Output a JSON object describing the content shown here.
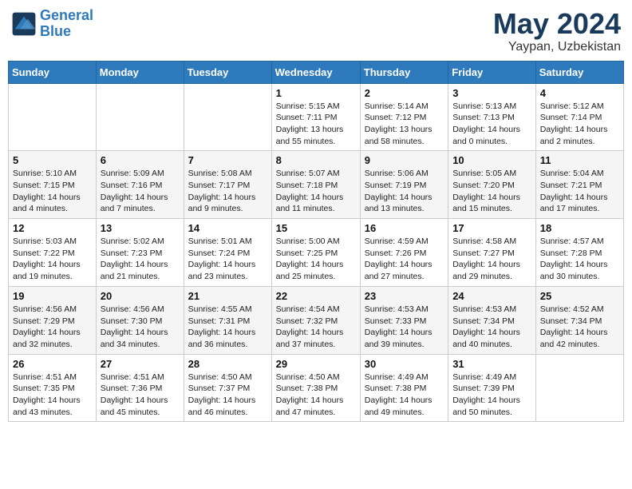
{
  "header": {
    "logo_line1": "General",
    "logo_line2": "Blue",
    "month_year": "May 2024",
    "location": "Yaypan, Uzbekistan"
  },
  "weekdays": [
    "Sunday",
    "Monday",
    "Tuesday",
    "Wednesday",
    "Thursday",
    "Friday",
    "Saturday"
  ],
  "weeks": [
    [
      {
        "day": "",
        "info": ""
      },
      {
        "day": "",
        "info": ""
      },
      {
        "day": "",
        "info": ""
      },
      {
        "day": "1",
        "info": "Sunrise: 5:15 AM\nSunset: 7:11 PM\nDaylight: 13 hours\nand 55 minutes."
      },
      {
        "day": "2",
        "info": "Sunrise: 5:14 AM\nSunset: 7:12 PM\nDaylight: 13 hours\nand 58 minutes."
      },
      {
        "day": "3",
        "info": "Sunrise: 5:13 AM\nSunset: 7:13 PM\nDaylight: 14 hours\nand 0 minutes."
      },
      {
        "day": "4",
        "info": "Sunrise: 5:12 AM\nSunset: 7:14 PM\nDaylight: 14 hours\nand 2 minutes."
      }
    ],
    [
      {
        "day": "5",
        "info": "Sunrise: 5:10 AM\nSunset: 7:15 PM\nDaylight: 14 hours\nand 4 minutes."
      },
      {
        "day": "6",
        "info": "Sunrise: 5:09 AM\nSunset: 7:16 PM\nDaylight: 14 hours\nand 7 minutes."
      },
      {
        "day": "7",
        "info": "Sunrise: 5:08 AM\nSunset: 7:17 PM\nDaylight: 14 hours\nand 9 minutes."
      },
      {
        "day": "8",
        "info": "Sunrise: 5:07 AM\nSunset: 7:18 PM\nDaylight: 14 hours\nand 11 minutes."
      },
      {
        "day": "9",
        "info": "Sunrise: 5:06 AM\nSunset: 7:19 PM\nDaylight: 14 hours\nand 13 minutes."
      },
      {
        "day": "10",
        "info": "Sunrise: 5:05 AM\nSunset: 7:20 PM\nDaylight: 14 hours\nand 15 minutes."
      },
      {
        "day": "11",
        "info": "Sunrise: 5:04 AM\nSunset: 7:21 PM\nDaylight: 14 hours\nand 17 minutes."
      }
    ],
    [
      {
        "day": "12",
        "info": "Sunrise: 5:03 AM\nSunset: 7:22 PM\nDaylight: 14 hours\nand 19 minutes."
      },
      {
        "day": "13",
        "info": "Sunrise: 5:02 AM\nSunset: 7:23 PM\nDaylight: 14 hours\nand 21 minutes."
      },
      {
        "day": "14",
        "info": "Sunrise: 5:01 AM\nSunset: 7:24 PM\nDaylight: 14 hours\nand 23 minutes."
      },
      {
        "day": "15",
        "info": "Sunrise: 5:00 AM\nSunset: 7:25 PM\nDaylight: 14 hours\nand 25 minutes."
      },
      {
        "day": "16",
        "info": "Sunrise: 4:59 AM\nSunset: 7:26 PM\nDaylight: 14 hours\nand 27 minutes."
      },
      {
        "day": "17",
        "info": "Sunrise: 4:58 AM\nSunset: 7:27 PM\nDaylight: 14 hours\nand 29 minutes."
      },
      {
        "day": "18",
        "info": "Sunrise: 4:57 AM\nSunset: 7:28 PM\nDaylight: 14 hours\nand 30 minutes."
      }
    ],
    [
      {
        "day": "19",
        "info": "Sunrise: 4:56 AM\nSunset: 7:29 PM\nDaylight: 14 hours\nand 32 minutes."
      },
      {
        "day": "20",
        "info": "Sunrise: 4:56 AM\nSunset: 7:30 PM\nDaylight: 14 hours\nand 34 minutes."
      },
      {
        "day": "21",
        "info": "Sunrise: 4:55 AM\nSunset: 7:31 PM\nDaylight: 14 hours\nand 36 minutes."
      },
      {
        "day": "22",
        "info": "Sunrise: 4:54 AM\nSunset: 7:32 PM\nDaylight: 14 hours\nand 37 minutes."
      },
      {
        "day": "23",
        "info": "Sunrise: 4:53 AM\nSunset: 7:33 PM\nDaylight: 14 hours\nand 39 minutes."
      },
      {
        "day": "24",
        "info": "Sunrise: 4:53 AM\nSunset: 7:34 PM\nDaylight: 14 hours\nand 40 minutes."
      },
      {
        "day": "25",
        "info": "Sunrise: 4:52 AM\nSunset: 7:34 PM\nDaylight: 14 hours\nand 42 minutes."
      }
    ],
    [
      {
        "day": "26",
        "info": "Sunrise: 4:51 AM\nSunset: 7:35 PM\nDaylight: 14 hours\nand 43 minutes."
      },
      {
        "day": "27",
        "info": "Sunrise: 4:51 AM\nSunset: 7:36 PM\nDaylight: 14 hours\nand 45 minutes."
      },
      {
        "day": "28",
        "info": "Sunrise: 4:50 AM\nSunset: 7:37 PM\nDaylight: 14 hours\nand 46 minutes."
      },
      {
        "day": "29",
        "info": "Sunrise: 4:50 AM\nSunset: 7:38 PM\nDaylight: 14 hours\nand 47 minutes."
      },
      {
        "day": "30",
        "info": "Sunrise: 4:49 AM\nSunset: 7:38 PM\nDaylight: 14 hours\nand 49 minutes."
      },
      {
        "day": "31",
        "info": "Sunrise: 4:49 AM\nSunset: 7:39 PM\nDaylight: 14 hours\nand 50 minutes."
      },
      {
        "day": "",
        "info": ""
      }
    ]
  ]
}
